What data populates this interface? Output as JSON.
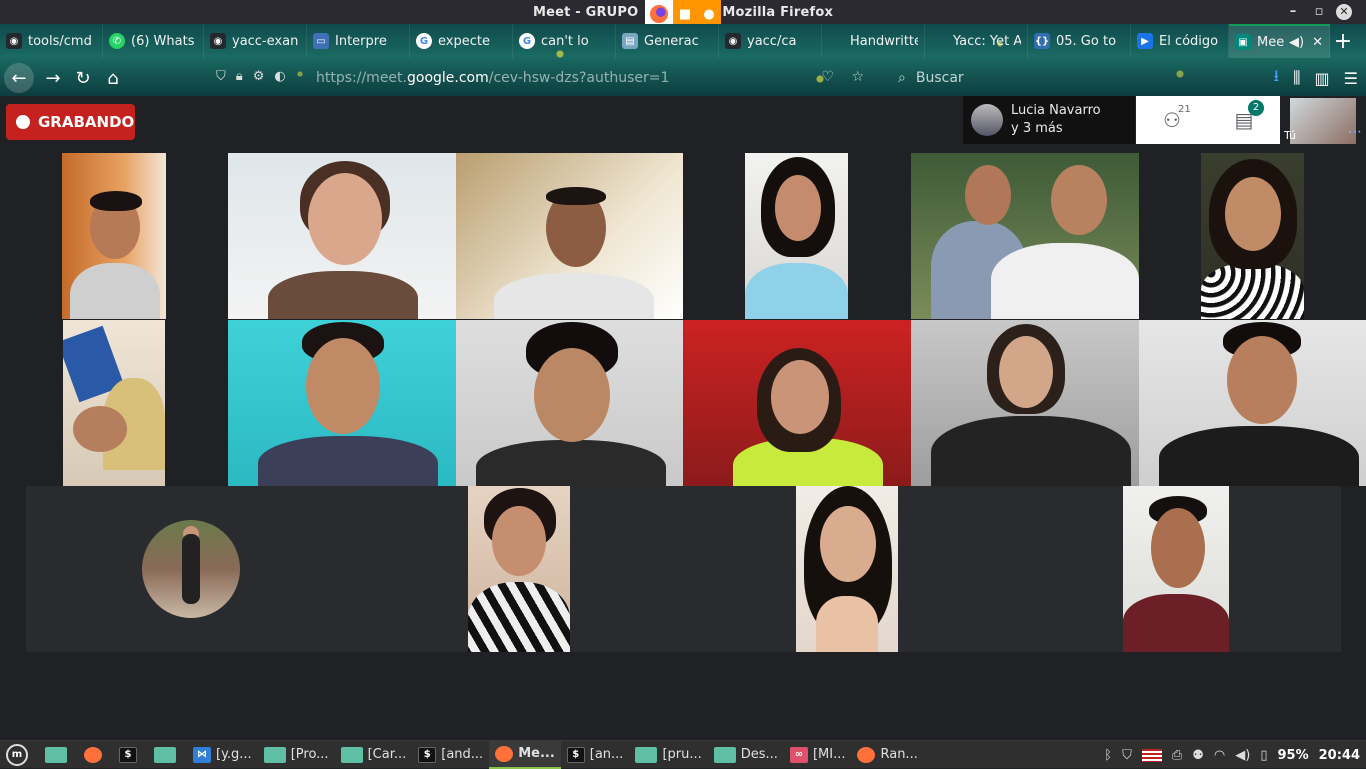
{
  "window": {
    "title": "Meet - GRUPO",
    "title_suffix": "Mozilla Firefox"
  },
  "tabs": [
    {
      "label": "tools/cmd",
      "icon": "github-icon",
      "color": "#24292e"
    },
    {
      "label": "(6) Whats",
      "icon": "whatsapp-icon",
      "color": "#25d366"
    },
    {
      "label": "yacc-exan",
      "icon": "github-icon",
      "color": "#24292e"
    },
    {
      "label": "Interpre",
      "icon": "monitor-icon",
      "color": "#3f6fb5"
    },
    {
      "label": "expecte",
      "icon": "google-icon",
      "color": "#ffffff"
    },
    {
      "label": "can't lo",
      "icon": "google-icon",
      "color": "#ffffff"
    },
    {
      "label": "Generac",
      "icon": "page-icon",
      "color": "#7aa6c2"
    },
    {
      "label": "yacc/ca",
      "icon": "github-icon",
      "color": "#24292e"
    },
    {
      "label": "Handwritte",
      "icon": "page-icon",
      "color": "#444"
    },
    {
      "label": "Yacc: Yet Ano",
      "icon": "page-icon",
      "color": "#444"
    },
    {
      "label": "05. Go to",
      "icon": "code-icon",
      "color": "#2f6fb0"
    },
    {
      "label": "El código",
      "icon": "video-icon",
      "color": "#1a73e8"
    },
    {
      "label": "Mee",
      "icon": "meet-icon",
      "color": "#00897b"
    }
  ],
  "nav": {
    "url": "https://meet.google.com/cev-hsw-dzs?authuser=1",
    "url_domain": "google.com",
    "search_placeholder": "Buscar"
  },
  "meet": {
    "recording_label": "GRABANDO",
    "presenter_name": "Lucia Navarro",
    "presenter_sub": "y 3 más",
    "participant_count": "21",
    "chat_badge": "2",
    "self_label": "Tú"
  },
  "taskbar": {
    "items": [
      {
        "label": "",
        "icon": "files-icon"
      },
      {
        "label": "",
        "icon": "firefox-icon"
      },
      {
        "label": "",
        "icon": "terminal-icon"
      },
      {
        "label": "",
        "icon": "folder-icon"
      },
      {
        "label": "[y.g...",
        "icon": "vscode-icon"
      },
      {
        "label": "[Pro...",
        "icon": "folder-icon"
      },
      {
        "label": "[Car...",
        "icon": "folder-icon"
      },
      {
        "label": "[and...",
        "icon": "terminal-icon"
      },
      {
        "label": "Me...",
        "icon": "firefox-icon",
        "active": true
      },
      {
        "label": "[an...",
        "icon": "terminal-icon"
      },
      {
        "label": "[pru...",
        "icon": "folder-icon"
      },
      {
        "label": "Des...",
        "icon": "folder-icon"
      },
      {
        "label": "[MI...",
        "icon": "glasses-icon"
      },
      {
        "label": "Ran...",
        "icon": "firefox-icon"
      }
    ],
    "battery": "95%",
    "time": "20:44"
  }
}
